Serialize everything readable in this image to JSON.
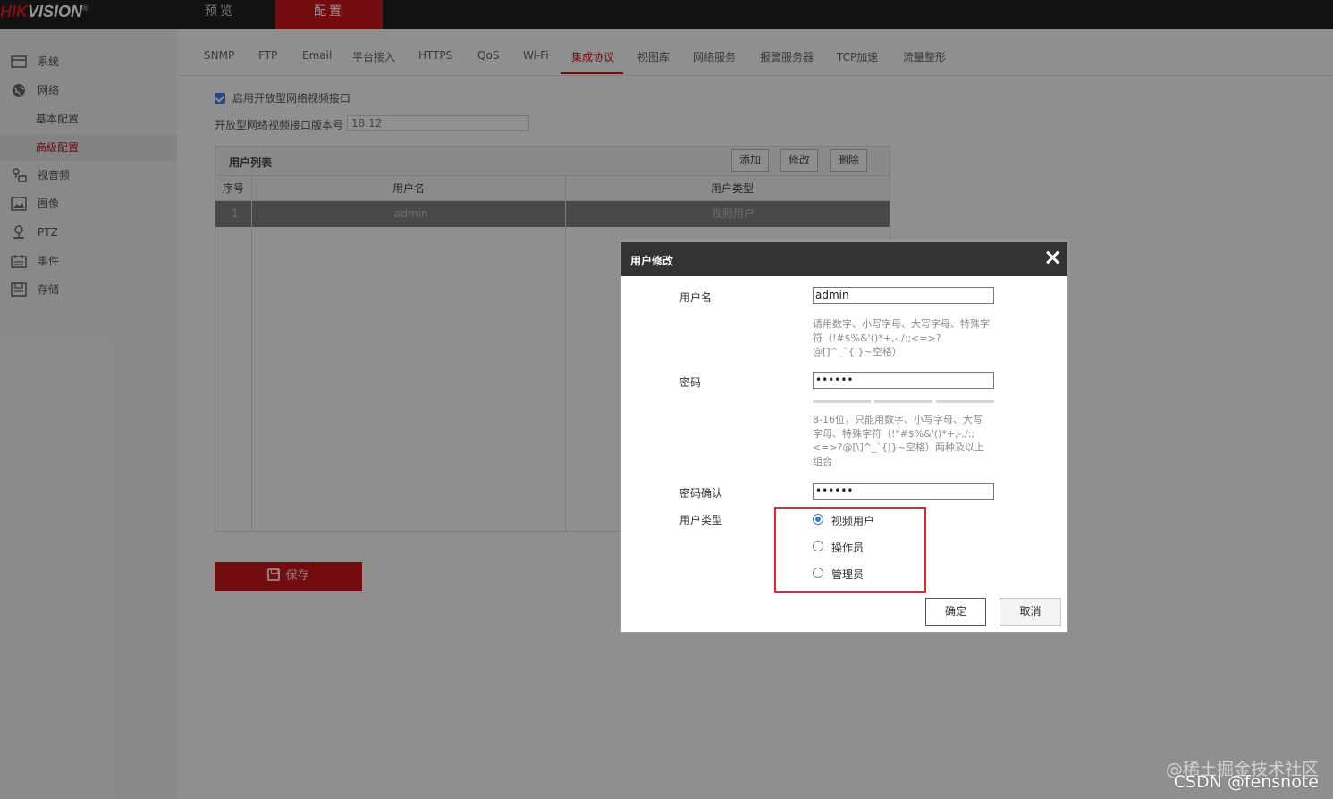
{
  "brand": {
    "logo_red": "HIK",
    "logo_white": "VISION",
    "registered": "®"
  },
  "topnav": {
    "preview": "预览",
    "config": "配置"
  },
  "sidebar": {
    "items": [
      {
        "label": "系统",
        "icon": "system-icon"
      },
      {
        "label": "网络",
        "icon": "network-globe-icon"
      },
      {
        "label": "视音频",
        "icon": "audio-video-icon"
      },
      {
        "label": "图像",
        "icon": "image-icon"
      },
      {
        "label": "PTZ",
        "icon": "ptz-icon"
      },
      {
        "label": "事件",
        "icon": "event-calendar-icon"
      },
      {
        "label": "存储",
        "icon": "storage-icon"
      }
    ],
    "network_sub": {
      "basic": "基本配置",
      "advanced": "高级配置"
    }
  },
  "tabs": [
    "SNMP",
    "FTP",
    "Email",
    "平台接入",
    "HTTPS",
    "QoS",
    "Wi-Fi",
    "集成协议",
    "视图库",
    "网络服务",
    "报警服务器",
    "TCP加速",
    "流量整形"
  ],
  "active_tab": "集成协议",
  "protocol": {
    "enable_label": "启用开放型网络视频接口",
    "enable_checked": true,
    "version_label": "开放型网络视频接口版本号",
    "version_value": "18.12"
  },
  "user_list": {
    "title": "用户列表",
    "add": "添加",
    "modify": "修改",
    "delete": "删除",
    "columns": [
      "序号",
      "用户名",
      "用户类型"
    ],
    "rows": [
      {
        "index": "1",
        "username": "admin",
        "type": "视频用户"
      }
    ]
  },
  "save_button": "保存",
  "dialog": {
    "title": "用户修改",
    "username_label": "用户名",
    "username_value": "admin",
    "username_hint": "请用数字、小写字母、大写字母、特殊字符（!#$%&'()*+,-./:;<=>?@[]^_`{|}~空格）",
    "password_label": "密码",
    "password_value": "••••••",
    "password_hint": "8-16位，只能用数字、小写字母、大写字母、特殊字符（!\"#$%&'()*+,-./:;<=>?@[\\]^_`{|}~空格）两种及以上组合",
    "confirm_label": "密码确认",
    "confirm_value": "••••••",
    "user_type_label": "用户类型",
    "user_types": [
      "视频用户",
      "操作员",
      "管理员"
    ],
    "selected_user_type": "视频用户",
    "ok": "确定",
    "cancel": "取消"
  },
  "watermark": {
    "line1": "@稀土掘金技术社区",
    "line2": "CSDN @fensnote"
  },
  "colors": {
    "brand_red": "#c4161c",
    "highlight_red": "#e3272d",
    "radio_blue": "#3d7bd9",
    "topbar": "#1f1f1f",
    "dialog_header": "#333333"
  }
}
